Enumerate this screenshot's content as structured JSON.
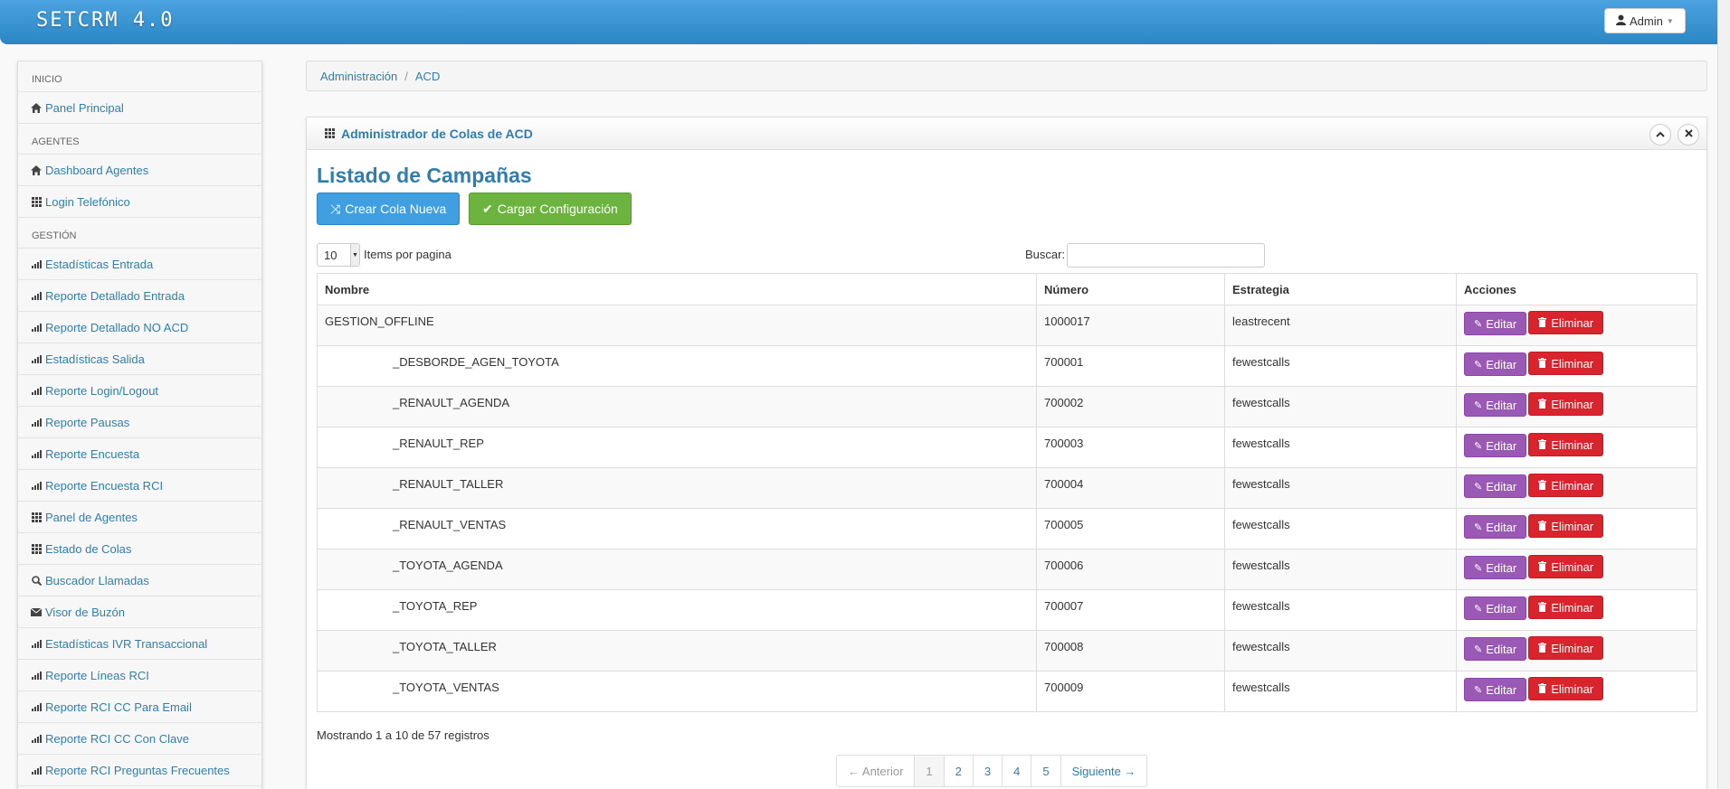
{
  "app": {
    "brand": "SETCRM 4.0",
    "user_label": "Admin"
  },
  "sidebar": {
    "sections": [
      {
        "label": "INICIO",
        "items": [
          {
            "label": "Panel Principal",
            "icon": "home-icon"
          }
        ]
      },
      {
        "label": "AGENTES",
        "items": [
          {
            "label": "Dashboard Agentes",
            "icon": "home-icon"
          },
          {
            "label": "Login Telefónico",
            "icon": "grid-icon"
          }
        ]
      },
      {
        "label": "GESTIÓN",
        "items": [
          {
            "label": "Estadísticas Entrada",
            "icon": "bar-chart-icon"
          },
          {
            "label": "Reporte Detallado Entrada",
            "icon": "bar-chart-icon"
          },
          {
            "label": "Reporte Detallado NO ACD",
            "icon": "bar-chart-icon"
          },
          {
            "label": "Estadísticas Salida",
            "icon": "bar-chart-icon"
          },
          {
            "label": "Reporte Login/Logout",
            "icon": "bar-chart-icon"
          },
          {
            "label": "Reporte Pausas",
            "icon": "bar-chart-icon"
          },
          {
            "label": "Reporte Encuesta",
            "icon": "bar-chart-icon"
          },
          {
            "label": "Reporte Encuesta RCI",
            "icon": "bar-chart-icon"
          },
          {
            "label": "Panel de Agentes",
            "icon": "grid-icon"
          },
          {
            "label": "Estado de Colas",
            "icon": "grid-icon"
          },
          {
            "label": "Buscador Llamadas",
            "icon": "search-icon"
          },
          {
            "label": "Visor de Buzón",
            "icon": "envelope-icon"
          },
          {
            "label": "Estadísticas IVR Transaccional",
            "icon": "bar-chart-icon"
          },
          {
            "label": "Reporte Líneas RCI",
            "icon": "bar-chart-icon"
          },
          {
            "label": "Reporte RCI CC Para Email",
            "icon": "bar-chart-icon"
          },
          {
            "label": "Reporte RCI CC Con Clave",
            "icon": "bar-chart-icon"
          },
          {
            "label": "Reporte RCI Preguntas Frecuentes",
            "icon": "bar-chart-icon"
          }
        ]
      }
    ]
  },
  "breadcrumb": {
    "items": [
      "Administración",
      "ACD"
    ],
    "separator": "/"
  },
  "box": {
    "title": "Administrador de Colas de ACD",
    "list_title": "Listado de Campañas",
    "create_button": "Crear Cola Nueva",
    "load_button": "Cargar Configuración"
  },
  "table_controls": {
    "page_size": "10",
    "page_size_label": "Items por pagina",
    "search_label": "Buscar:"
  },
  "table": {
    "columns": [
      "Nombre",
      "Número",
      "Estrategia",
      "Acciones"
    ],
    "edit_label": "Editar",
    "delete_label": "Eliminar",
    "rows": [
      {
        "name": "GESTION_OFFLINE",
        "number": "1000017",
        "strategy": "leastrecent",
        "indent": false
      },
      {
        "name": "_DESBORDE_AGEN_TOYOTA",
        "number": "700001",
        "strategy": "fewestcalls",
        "indent": true
      },
      {
        "name": "_RENAULT_AGENDA",
        "number": "700002",
        "strategy": "fewestcalls",
        "indent": true
      },
      {
        "name": "_RENAULT_REP",
        "number": "700003",
        "strategy": "fewestcalls",
        "indent": true
      },
      {
        "name": "_RENAULT_TALLER",
        "number": "700004",
        "strategy": "fewestcalls",
        "indent": true
      },
      {
        "name": "_RENAULT_VENTAS",
        "number": "700005",
        "strategy": "fewestcalls",
        "indent": true
      },
      {
        "name": "_TOYOTA_AGENDA",
        "number": "700006",
        "strategy": "fewestcalls",
        "indent": true
      },
      {
        "name": "_TOYOTA_REP",
        "number": "700007",
        "strategy": "fewestcalls",
        "indent": true
      },
      {
        "name": "_TOYOTA_TALLER",
        "number": "700008",
        "strategy": "fewestcalls",
        "indent": true
      },
      {
        "name": "_TOYOTA_VENTAS",
        "number": "700009",
        "strategy": "fewestcalls",
        "indent": true
      }
    ]
  },
  "footer": {
    "info": "Mostrando 1 a 10 de 57 registros",
    "prev": "← Anterior",
    "next": "Siguiente →",
    "pages": [
      "1",
      "2",
      "3",
      "4",
      "5"
    ],
    "active_page": "1"
  }
}
